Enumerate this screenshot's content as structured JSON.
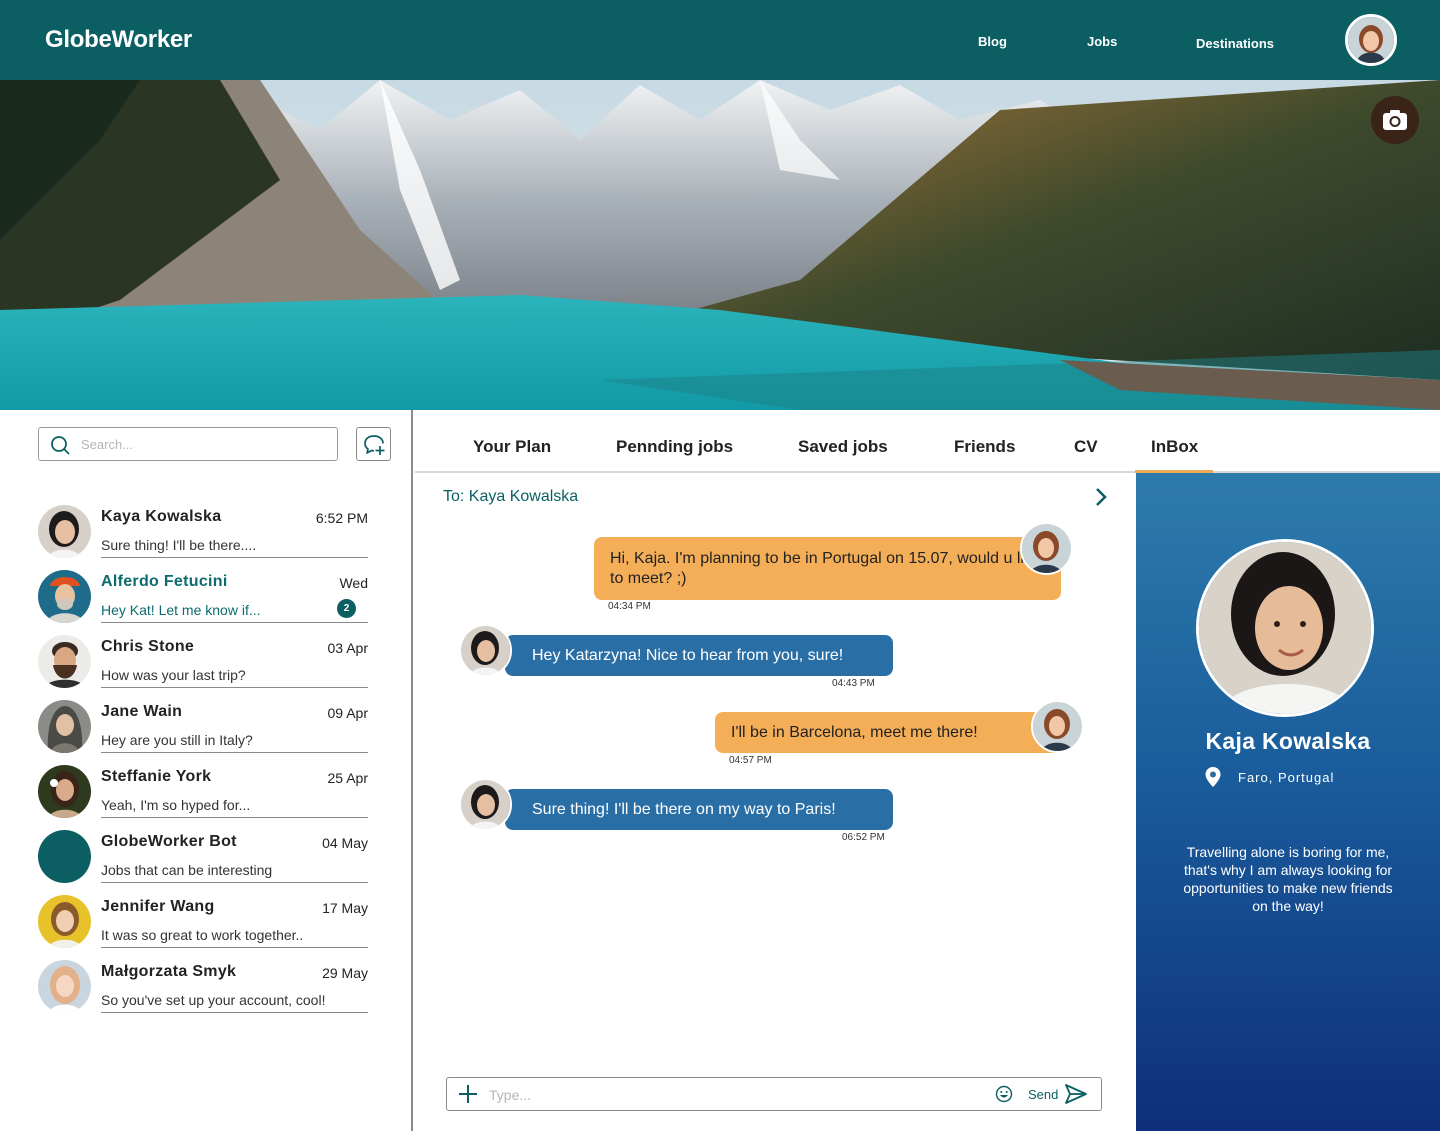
{
  "app": {
    "logo": "GlobeWorker",
    "nav": [
      "Blog",
      "Jobs",
      "Destinations"
    ]
  },
  "search": {
    "placeholder": "Search..."
  },
  "conversations": [
    {
      "name": "Kaya Kowalska",
      "time": "6:52 PM",
      "preview": "Sure thing! I'll be there....",
      "active": false
    },
    {
      "name": "Alferdo Fetucini",
      "time": "Wed",
      "preview": "Hey Kat! Let me know if...",
      "active": true,
      "unread": "2"
    },
    {
      "name": "Chris Stone",
      "time": "03 Apr",
      "preview": "How was your last trip?"
    },
    {
      "name": "Jane Wain",
      "time": "09 Apr",
      "preview": "Hey are you still in Italy?"
    },
    {
      "name": "Steffanie York",
      "time": "25 Apr",
      "preview": "Yeah, I'm so hyped for..."
    },
    {
      "name": "GlobeWorker Bot",
      "time": "04 May",
      "preview": "Jobs that can be interesting"
    },
    {
      "name": "Jennifer Wang",
      "time": "17 May",
      "preview": "It was so great to work together.."
    },
    {
      "name": "Małgorzata Smyk",
      "time": "29 May",
      "preview": "So you've set up your account, cool!"
    }
  ],
  "tabs": [
    "Your Plan",
    "Pennding jobs",
    "Saved jobs",
    "Friends",
    "CV",
    "InBox"
  ],
  "active_tab": "InBox",
  "chat": {
    "to": "To: Kaya Kowalska",
    "messages": [
      {
        "direction": "out",
        "text": "Hi, Kaja. I'm planning to be in Portugal on 15.07, would u like to meet? ;)",
        "time": "04:34 PM"
      },
      {
        "direction": "in",
        "text": "Hey Katarzyna! Nice to hear from you, sure!",
        "time": "04:43 PM"
      },
      {
        "direction": "out",
        "text": "I'll be in Barcelona, meet me there!",
        "time": "04:57 PM"
      },
      {
        "direction": "in",
        "text": "Sure thing! I'll be there on my way to Paris!",
        "time": "06:52 PM"
      }
    ],
    "input_placeholder": "Type...",
    "send_label": "Send"
  },
  "profile": {
    "name": "Kaja Kowalska",
    "location": "Faro, Portugal",
    "bio": "Travelling alone is boring for me, that's why I am always looking for opportunities to make new friends on the way!"
  },
  "colors": {
    "brand": "#0b5f63",
    "accent": "#f0ac55",
    "incoming_bubble": "#2a6ea6",
    "outgoing_bubble": "#f3ae57"
  },
  "icons": [
    "search-icon",
    "new-chat-icon",
    "camera-icon",
    "chevron-right-icon",
    "plus-icon",
    "emoji-icon",
    "send-icon",
    "location-pin-icon"
  ]
}
